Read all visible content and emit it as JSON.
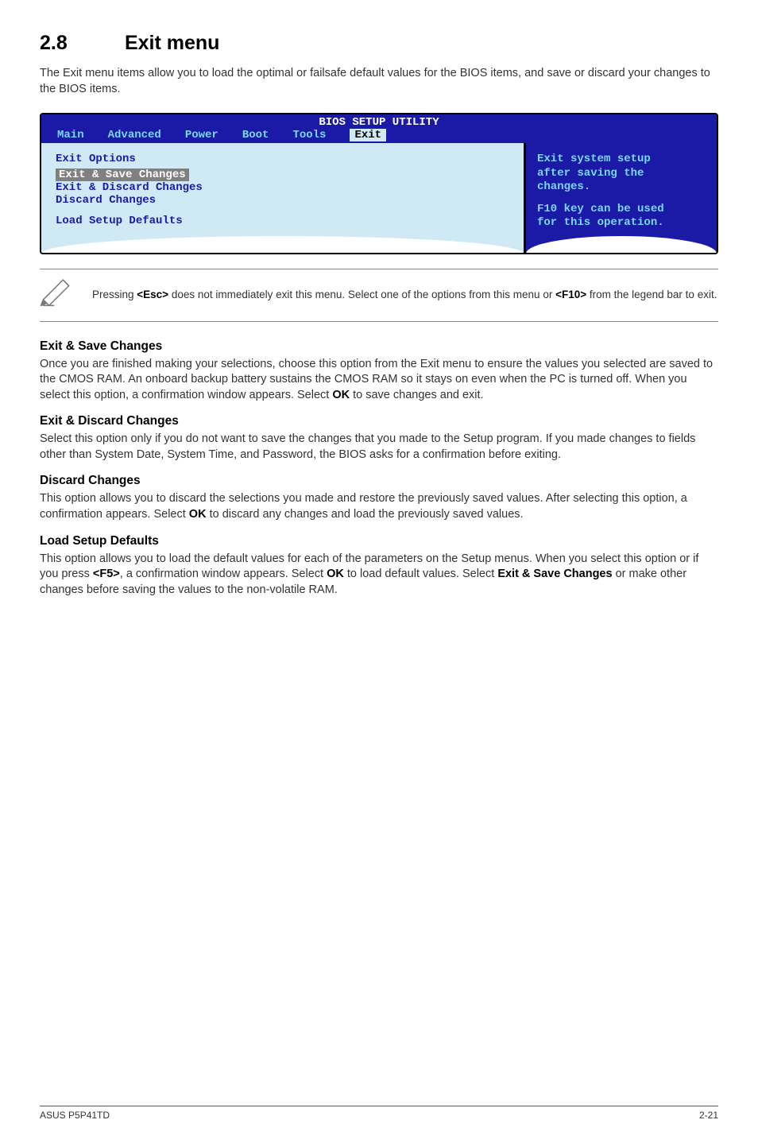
{
  "section": {
    "number": "2.8",
    "title": "Exit menu",
    "intro": "The Exit menu items allow you to load the optimal or failsafe default values for the BIOS items, and save or discard your changes to the BIOS items."
  },
  "bios": {
    "title": "BIOS SETUP UTILITY",
    "tabs": [
      "Main",
      "Advanced",
      "Power",
      "Boot",
      "Tools",
      "Exit"
    ],
    "active_tab": "Exit",
    "left": {
      "heading": "Exit Options",
      "items": [
        "Exit & Save Changes",
        "Exit & Discard Changes",
        "Discard Changes",
        "Load Setup Defaults"
      ]
    },
    "right": {
      "line1": "Exit system setup",
      "line2": "after saving the",
      "line3": "changes.",
      "line4": "F10 key can be used",
      "line5": "for this operation."
    }
  },
  "note": {
    "text_a": "Pressing ",
    "key1": "<Esc>",
    "text_b": " does not immediately exit this menu. Select one of the options from this menu or ",
    "key2": "<F10>",
    "text_c": " from the legend bar to exit."
  },
  "subs": {
    "s1_h": "Exit & Save Changes",
    "s1_t_a": "Once you are finished making your selections, choose this option from the Exit menu to ensure the values you selected are saved to the CMOS RAM. An onboard backup battery sustains the CMOS RAM so it stays on even when the PC is turned off. When you select this option, a confirmation window appears. Select ",
    "s1_ok": "OK",
    "s1_t_b": " to save changes and exit.",
    "s2_h": "Exit & Discard Changes",
    "s2_t": "Select this option only if you do not want to save the changes that you made to the Setup program. If you made changes to fields other than System Date, System Time, and Password, the BIOS asks for a confirmation before exiting.",
    "s3_h": "Discard Changes",
    "s3_t_a": "This option allows you to discard the selections you made and restore the previously saved values. After selecting this option, a confirmation appears. Select ",
    "s3_ok": "OK",
    "s3_t_b": " to discard any changes and load the previously saved values.",
    "s4_h": "Load Setup Defaults",
    "s4_t_a": "This option allows you to load the default values for each of the parameters on the Setup menus. When you select this option or if you press ",
    "s4_f5": "<F5>",
    "s4_t_b": ", a confirmation window appears. Select ",
    "s4_ok": "OK",
    "s4_t_c": " to load default values. Select ",
    "s4_exit": "Exit & Save Changes",
    "s4_t_d": " or make other changes before saving the values to the non-volatile RAM."
  },
  "footer": {
    "left": "ASUS P5P41TD",
    "right": "2-21"
  }
}
